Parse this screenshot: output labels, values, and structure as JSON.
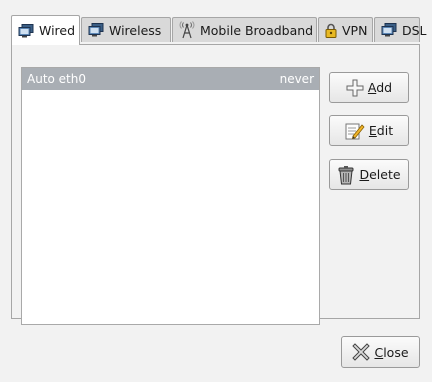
{
  "tabs": [
    {
      "label": "Wired",
      "icon": "network-wired-icon",
      "active": true
    },
    {
      "label": "Wireless",
      "icon": "network-wireless-icon",
      "active": false
    },
    {
      "label": "Mobile Broadband",
      "icon": "antenna-icon",
      "active": false
    },
    {
      "label": "VPN",
      "icon": "lock-icon",
      "active": false
    },
    {
      "label": "DSL",
      "icon": "network-dsl-icon",
      "active": false
    }
  ],
  "connections": [
    {
      "name": "Auto eth0",
      "last_used": "never"
    }
  ],
  "buttons": {
    "add": "Add",
    "edit": "Edit",
    "delete": "Delete",
    "close": "Close"
  },
  "colors": {
    "selected_row": "#a9aeb4",
    "background": "#f2f2f2"
  }
}
